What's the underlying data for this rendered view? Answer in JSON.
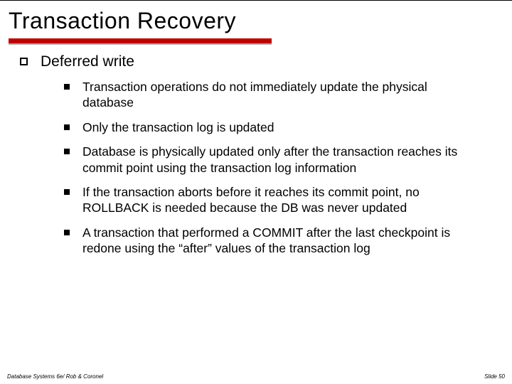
{
  "title": "Transaction Recovery",
  "level1": "Deferred write",
  "points": [
    "Transaction operations do not immediately update the physical database",
    "Only the transaction log is updated",
    "Database is physically updated only after the transaction reaches its commit point using the transaction log information",
    "If the transaction aborts before it reaches its commit point, no ROLLBACK is needed because the DB was never updated",
    "A transaction that performed a COMMIT after the last checkpoint is redone using the “after” values of the transaction log"
  ],
  "footer_left": "Database Systems 6e/ Rob & Coronel",
  "footer_right": "Slide 50"
}
